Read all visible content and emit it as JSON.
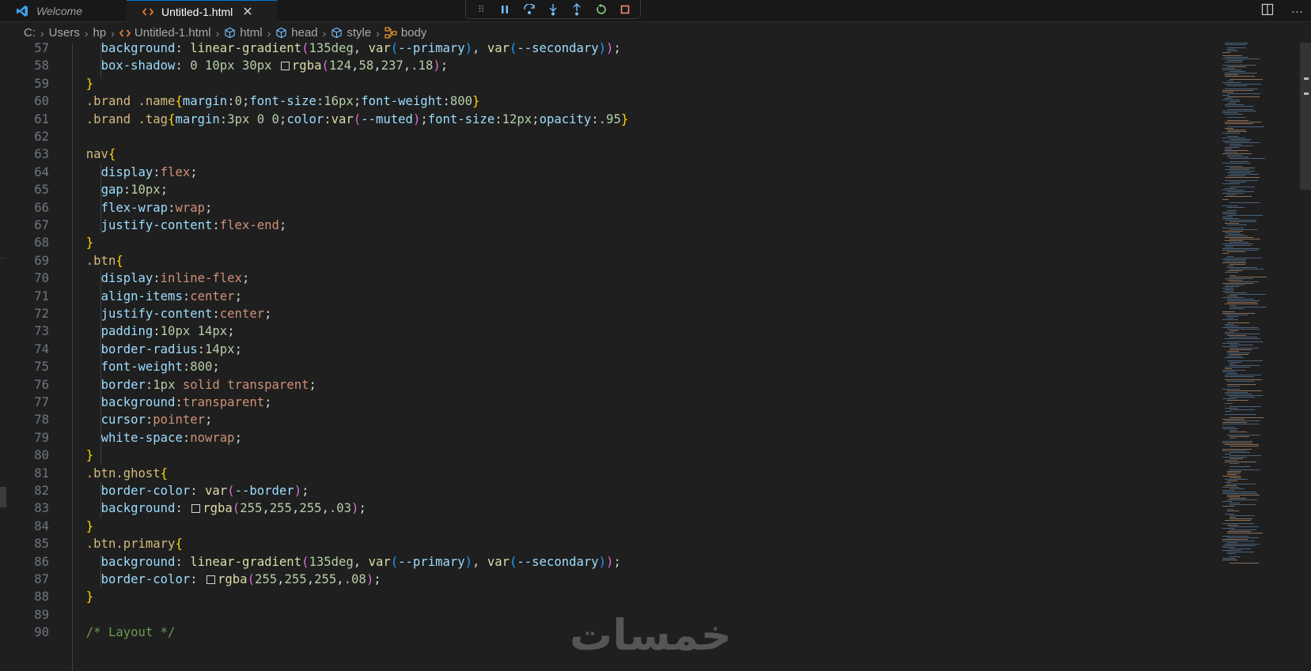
{
  "tabs": [
    {
      "label": "Welcome",
      "icon": "vscode-icon"
    },
    {
      "label": "Untitled-1.html",
      "icon": "html-code-icon"
    }
  ],
  "breadcrumb": [
    "C:",
    "Users",
    "hp",
    "Untitled-1.html",
    "html",
    "head",
    "style",
    "body"
  ],
  "debug_toolbar": [
    "pause-icon",
    "step-over-icon",
    "step-into-icon",
    "step-out-icon",
    "restart-icon",
    "stop-icon"
  ],
  "colors": {
    "editor_bg": "#1f1f1f",
    "tab_bar_bg": "#181818",
    "selector": "#d7ba7d",
    "property": "#9cdcfe",
    "value": "#ce9178",
    "number": "#b5cea8",
    "function": "#dcdcaa",
    "line_number": "#6e7681",
    "accent": "#0078d4"
  },
  "editor": {
    "lines": [
      {
        "n": "57",
        "text": "    background: linear-gradient(135deg, var(--primary), var(--secondary));"
      },
      {
        "n": "58",
        "text": "    box-shadow: 0 10px 30px rgba(124,58,237,.18);"
      },
      {
        "n": "59",
        "text": "  }"
      },
      {
        "n": "60",
        "text": "  .brand .name{margin:0;font-size:16px;font-weight:800}"
      },
      {
        "n": "61",
        "text": "  .brand .tag{margin:3px 0 0;color:var(--muted);font-size:12px;opacity:.95}"
      },
      {
        "n": "62",
        "text": ""
      },
      {
        "n": "63",
        "text": "  nav{"
      },
      {
        "n": "64",
        "text": "    display:flex;"
      },
      {
        "n": "65",
        "text": "    gap:10px;"
      },
      {
        "n": "66",
        "text": "    flex-wrap:wrap;"
      },
      {
        "n": "67",
        "text": "    justify-content:flex-end;"
      },
      {
        "n": "68",
        "text": "  }"
      },
      {
        "n": "69",
        "text": "  .btn{"
      },
      {
        "n": "70",
        "text": "    display:inline-flex;"
      },
      {
        "n": "71",
        "text": "    align-items:center;"
      },
      {
        "n": "72",
        "text": "    justify-content:center;"
      },
      {
        "n": "73",
        "text": "    padding:10px 14px;"
      },
      {
        "n": "74",
        "text": "    border-radius:14px;"
      },
      {
        "n": "75",
        "text": "    font-weight:800;"
      },
      {
        "n": "76",
        "text": "    border:1px solid transparent;"
      },
      {
        "n": "77",
        "text": "    background:transparent;"
      },
      {
        "n": "78",
        "text": "    cursor:pointer;"
      },
      {
        "n": "79",
        "text": "    white-space:nowrap;"
      },
      {
        "n": "80",
        "text": "  }"
      },
      {
        "n": "81",
        "text": "  .btn.ghost{"
      },
      {
        "n": "82",
        "text": "    border-color: var(--border);"
      },
      {
        "n": "83",
        "text": "    background: rgba(255,255,255,.03);"
      },
      {
        "n": "84",
        "text": "  }"
      },
      {
        "n": "85",
        "text": "  .btn.primary{"
      },
      {
        "n": "86",
        "text": "    background: linear-gradient(135deg, var(--primary), var(--secondary));"
      },
      {
        "n": "87",
        "text": "    border-color: rgba(255,255,255,.08);"
      },
      {
        "n": "88",
        "text": "  }"
      },
      {
        "n": "89",
        "text": ""
      },
      {
        "n": "90",
        "text": "  /* Layout */"
      }
    ]
  },
  "watermark": "خمسات"
}
